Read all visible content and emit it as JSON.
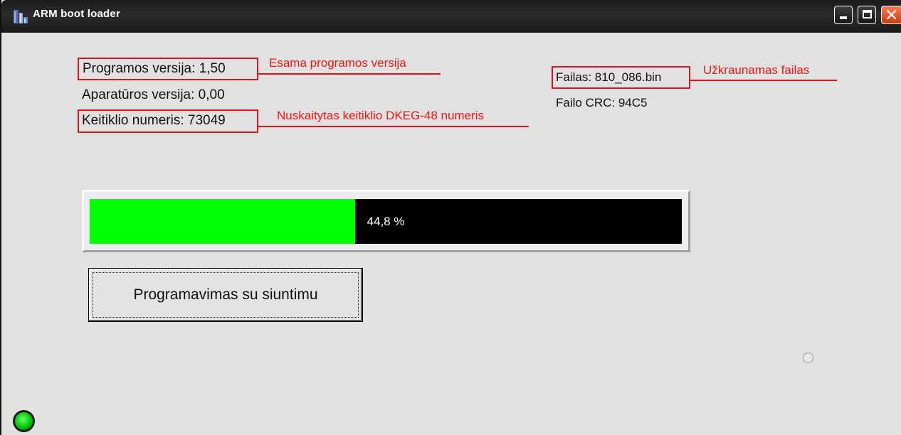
{
  "window": {
    "title": "ARM boot loader",
    "icon": "app-building-icon",
    "controls": [
      "minimize-icon",
      "maximize-icon",
      "close-icon"
    ],
    "close_glyph": "✕"
  },
  "info": {
    "program_version": "Programos versija:  1,50",
    "hardware_version": "Aparatūros versija: 0,00",
    "converter_number": "Keitiklio numeris:  73049",
    "file": "Failas:  810_086.bin",
    "file_crc": "Failo CRC:  94C5"
  },
  "annotations": {
    "program_version": "Esama programos versija",
    "converter_number": "Nuskaitytas keitiklio DKEG-48 numeris",
    "file": "Užkraunamas failas",
    "color": "#e0141a"
  },
  "progress": {
    "label": "44,8 %",
    "percent": 44.8,
    "fill_color": "#00ff00",
    "track_color": "#000000"
  },
  "buttons": {
    "program_send": "Programavimas su siuntimu"
  },
  "status": {
    "led_color": "#00d000"
  }
}
